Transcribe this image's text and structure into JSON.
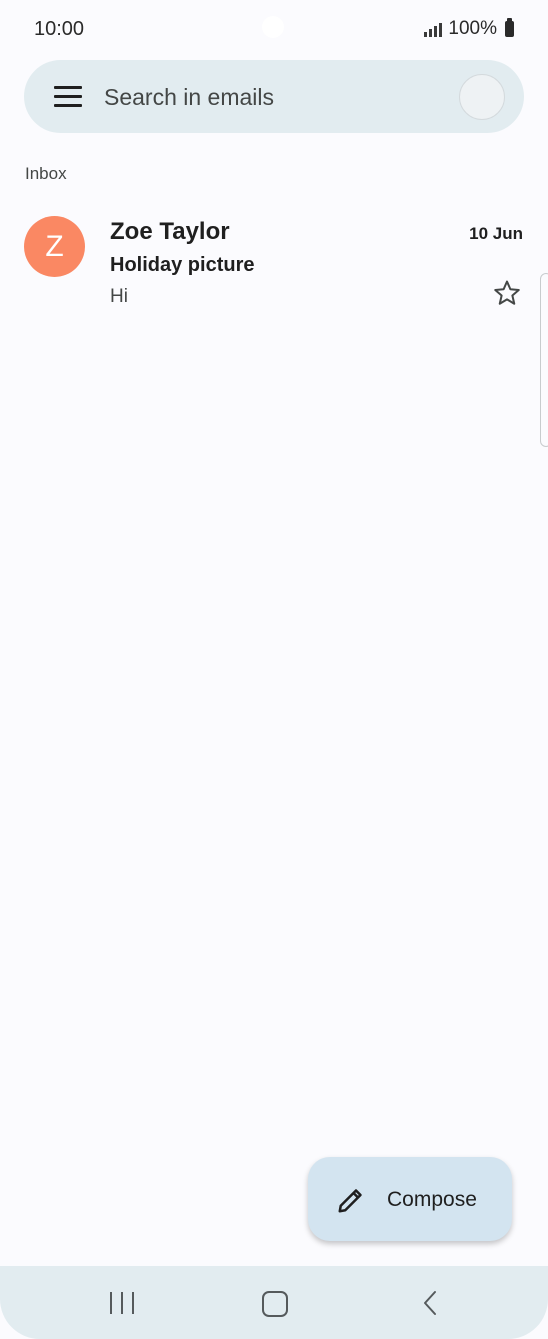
{
  "status_bar": {
    "time": "10:00",
    "battery": "100%"
  },
  "search": {
    "placeholder": "Search in emails"
  },
  "section": {
    "label": "Inbox"
  },
  "emails": [
    {
      "avatar_letter": "Z",
      "avatar_color": "#fa8863",
      "sender": "Zoe Taylor",
      "date": "10 Jun",
      "subject": "Holiday picture",
      "snippet": "Hi",
      "starred": false
    }
  ],
  "compose": {
    "label": "Compose",
    "icon": "pencil-icon"
  },
  "nav": {
    "icons": [
      "recents-icon",
      "home-icon",
      "back-icon"
    ]
  },
  "colors": {
    "background": "#fbfbfe",
    "search_bar": "#e2ecf0",
    "compose_fab": "#d3e4f0"
  }
}
